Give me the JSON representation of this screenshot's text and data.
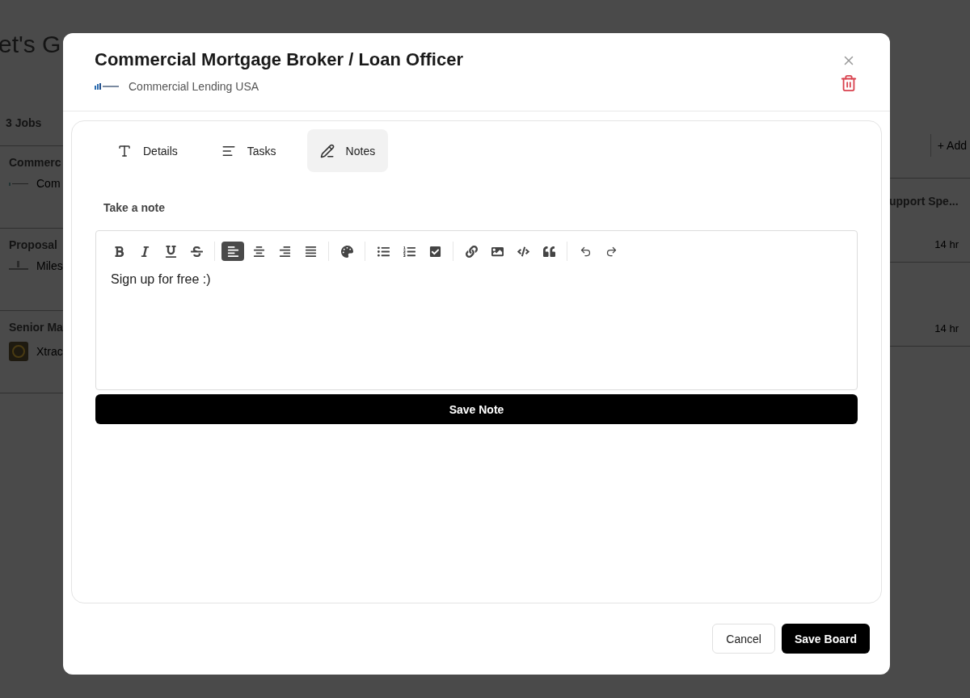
{
  "background": {
    "heading": "et's G",
    "jobs_count": "3 Jobs",
    "add_button": "+ Add",
    "left_cards": [
      {
        "title": "Commerc",
        "company": "Com",
        "kind": "bars"
      },
      {
        "title": "Proposal",
        "company": "Miles",
        "kind": "figure"
      },
      {
        "title": "Senior Ma",
        "company": "Xtrac",
        "kind": "dark"
      }
    ],
    "right_cards": [
      {
        "title": "upport Spe...",
        "time": "14 hr"
      },
      {
        "time": "14 hr"
      }
    ]
  },
  "modal": {
    "title": "Commercial Mortgage Broker / Loan Officer",
    "company": "Commercial Lending USA",
    "tabs": [
      {
        "label": "Details",
        "kind": "text",
        "selected": false
      },
      {
        "label": "Tasks",
        "kind": "list",
        "selected": false
      },
      {
        "label": "Notes",
        "kind": "pen",
        "selected": true
      }
    ],
    "note_label": "Take a note",
    "toolbar": [
      [
        {
          "kind": "bold",
          "selected": false
        },
        {
          "kind": "italic",
          "selected": false
        },
        {
          "kind": "underline",
          "selected": false
        },
        {
          "kind": "strike",
          "selected": false
        }
      ],
      [
        {
          "kind": "align-left",
          "selected": true
        },
        {
          "kind": "align-center",
          "selected": false
        },
        {
          "kind": "align-right",
          "selected": false
        },
        {
          "kind": "align-justify",
          "selected": false
        }
      ],
      [
        {
          "kind": "palette",
          "selected": false
        }
      ],
      [
        {
          "kind": "bullet-list",
          "selected": false
        },
        {
          "kind": "number-list",
          "selected": false
        },
        {
          "kind": "checkbox",
          "selected": false
        }
      ],
      [
        {
          "kind": "link",
          "selected": false
        },
        {
          "kind": "image",
          "selected": false
        },
        {
          "kind": "code",
          "selected": false
        },
        {
          "kind": "quote",
          "selected": false
        }
      ],
      [
        {
          "kind": "undo",
          "selected": false
        },
        {
          "kind": "redo",
          "selected": false
        }
      ]
    ],
    "note_text": "Sign up for free :)",
    "save_note": "Save Note",
    "cancel": "Cancel",
    "save_board": "Save Board"
  }
}
